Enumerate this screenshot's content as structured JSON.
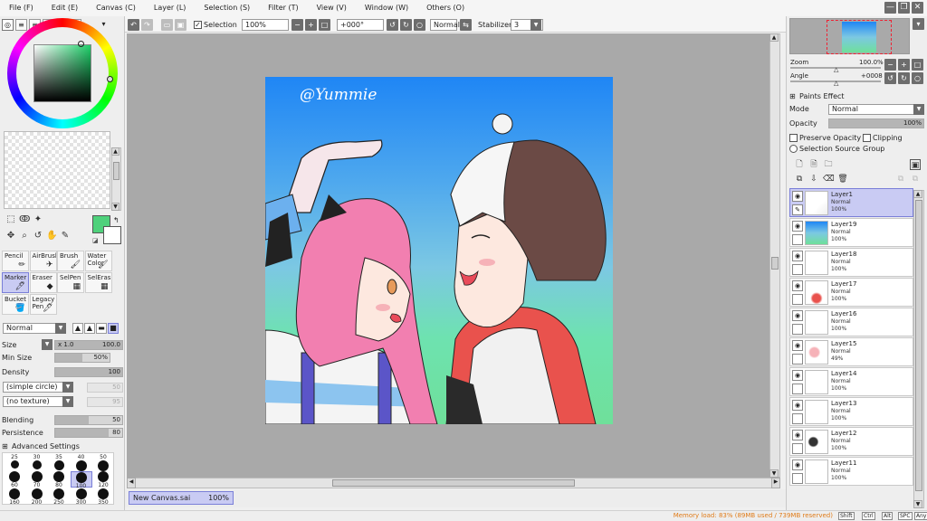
{
  "menu": [
    {
      "id": "file",
      "label": "File (F)"
    },
    {
      "id": "edit",
      "label": "Edit (E)"
    },
    {
      "id": "canvas",
      "label": "Canvas (C)"
    },
    {
      "id": "layer",
      "label": "Layer (L)"
    },
    {
      "id": "selection",
      "label": "Selection (S)"
    },
    {
      "id": "filter",
      "label": "Filter (T)"
    },
    {
      "id": "view",
      "label": "View (V)"
    },
    {
      "id": "window",
      "label": "Window (W)"
    },
    {
      "id": "others",
      "label": "Others (O)"
    }
  ],
  "window_controls": {
    "minimize": "—",
    "restore": "❐",
    "close": "✕"
  },
  "toolbar": {
    "selection_label": "Selection",
    "selection_checked": true,
    "zoom_value": "100%",
    "angle_value": "+000°",
    "blend_mode": "Normal",
    "stabilizer_label": "Stabilizer",
    "stabilizer_value": "3"
  },
  "colors": {
    "foreground": "#4ed17b",
    "background": "#ffffff",
    "accent_selected": "#c9cbf3",
    "memory_text": "#e07b18"
  },
  "tools": [
    {
      "id": "pencil",
      "label": "Pencil",
      "icon": "pencil-icon",
      "active": false
    },
    {
      "id": "airbrush",
      "label": "AirBrush",
      "icon": "airbrush-icon",
      "active": false
    },
    {
      "id": "brush",
      "label": "Brush",
      "icon": "brush-icon",
      "active": false
    },
    {
      "id": "watercolor",
      "label": "Water Color",
      "icon": "watercolor-icon",
      "active": false
    },
    {
      "id": "marker",
      "label": "Marker",
      "icon": "marker-icon",
      "active": true
    },
    {
      "id": "eraser",
      "label": "Eraser",
      "icon": "eraser-icon",
      "active": false
    },
    {
      "id": "selpen",
      "label": "SelPen",
      "icon": "selpen-icon",
      "active": false
    },
    {
      "id": "seleras",
      "label": "SelEras",
      "icon": "seleras-icon",
      "active": false
    },
    {
      "id": "bucket",
      "label": "Bucket",
      "icon": "bucket-icon",
      "active": false
    },
    {
      "id": "legacypen",
      "label": "Legacy Pen",
      "icon": "legacy-pen-icon",
      "active": false
    }
  ],
  "brush": {
    "mode": "Normal",
    "size_label": "Size",
    "size_multiplier": "x 1.0",
    "size_value": "100.0",
    "min_size_label": "Min Size",
    "min_size_value": "50%",
    "min_size_fraction": 0.5,
    "density_label": "Density",
    "density_value": "100",
    "density_fraction": 1.0,
    "shape": "(simple circle)",
    "shape_value": "50",
    "texture": "(no texture)",
    "texture_value": "95",
    "blending_label": "Blending",
    "blending_value": "50",
    "blending_fraction": 0.5,
    "persistence_label": "Persistence",
    "persistence_value": "80",
    "persistence_fraction": 0.8,
    "advanced_label": "Advanced Settings",
    "sizes": [
      "25",
      "30",
      "35",
      "40",
      "50",
      "60",
      "70",
      "80",
      "100",
      "120",
      "160",
      "200",
      "250",
      "300",
      "350"
    ],
    "selected_size": "100"
  },
  "canvas": {
    "watermark": "@Yummie"
  },
  "document": {
    "tab_name": "New Canvas.sai",
    "tab_zoom": "100%"
  },
  "navigator": {
    "zoom_label": "Zoom",
    "zoom_value": "100.0%",
    "angle_label": "Angle",
    "angle_value": "+0008"
  },
  "layer_props": {
    "paints_effect": "Paints Effect",
    "mode_label": "Mode",
    "mode_value": "Normal",
    "opacity_label": "Opacity",
    "opacity_value": "100%",
    "opacity_fraction": 1.0,
    "preserve_opacity": "Preserve Opacity",
    "clipping_group": "Clipping Group",
    "selection_source": "Selection Source"
  },
  "layers": [
    {
      "name": "Layer1",
      "mode": "Normal",
      "opacity": "100%",
      "active": true,
      "thumb": "sketch"
    },
    {
      "name": "Layer19",
      "mode": "Normal",
      "opacity": "100%",
      "active": false,
      "thumb": "sky"
    },
    {
      "name": "Layer18",
      "mode": "Normal",
      "opacity": "100%",
      "active": false,
      "thumb": "blank"
    },
    {
      "name": "Layer17",
      "mode": "Normal",
      "opacity": "100%",
      "active": false,
      "thumb": "red"
    },
    {
      "name": "Layer16",
      "mode": "Normal",
      "opacity": "100%",
      "active": false,
      "thumb": "blank"
    },
    {
      "name": "Layer15",
      "mode": "Normal",
      "opacity": "49%",
      "active": false,
      "thumb": "pink"
    },
    {
      "name": "Layer14",
      "mode": "Normal",
      "opacity": "100%",
      "active": false,
      "thumb": "blank"
    },
    {
      "name": "Layer13",
      "mode": "Normal",
      "opacity": "100%",
      "active": false,
      "thumb": "blank"
    },
    {
      "name": "Layer12",
      "mode": "Normal",
      "opacity": "100%",
      "active": false,
      "thumb": "dark"
    },
    {
      "name": "Layer11",
      "mode": "Normal",
      "opacity": "100%",
      "active": false,
      "thumb": "blank"
    }
  ],
  "status": {
    "memory": "Memory load: 83% (89MB used / 739MB reserved)",
    "keys": [
      "Shift",
      "Ctrl",
      "Alt",
      "SPC",
      "Any"
    ]
  }
}
